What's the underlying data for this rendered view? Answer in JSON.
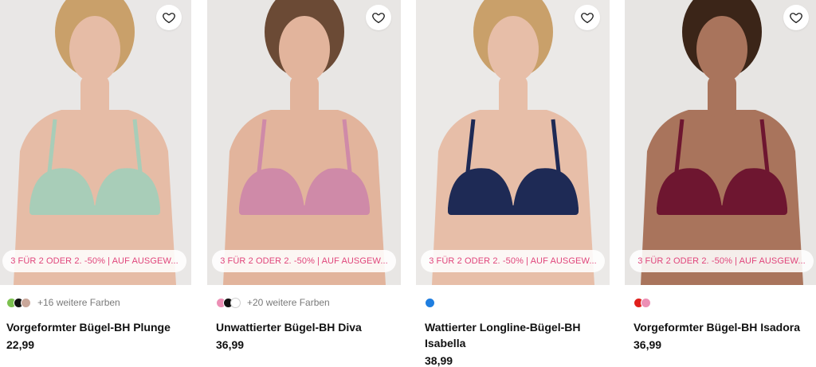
{
  "promo_text": "3 FÜR 2 ODER 2. -50% | AUF AUSGEW...",
  "products": [
    {
      "title": "Vorgeformter Bügel-BH Plunge",
      "price": "22,99",
      "swatches": [
        "#7cc04f",
        "#111111",
        "#c9a79a"
      ],
      "more_colors": "+16 weitere Farben",
      "bg": "#e9e7e6",
      "skin": "#e6bca6",
      "hair": "#c9a06a",
      "bra": "#a8cdb8"
    },
    {
      "title": "Unwattierter Bügel-BH Diva",
      "price": "36,99",
      "swatches": [
        "#ec8fb5",
        "#111111",
        "#ffffff"
      ],
      "more_colors": "+20 weitere Farben",
      "bg": "#e8e6e4",
      "skin": "#e2b49c",
      "hair": "#6b4a35",
      "bra": "#cf8aa8"
    },
    {
      "title": "Wattierter Longline-Bügel-BH Isabella",
      "price": "38,99",
      "swatches": [
        "#1f7ee0"
      ],
      "more_colors": "",
      "bg": "#ebe9e7",
      "skin": "#e7bea8",
      "hair": "#c9a06a",
      "bra": "#1e2a55"
    },
    {
      "title": "Vorgeformter Bügel-BH Isadora",
      "price": "36,99",
      "swatches": [
        "#e0201c",
        "#ec8fb5"
      ],
      "more_colors": "",
      "bg": "#e7e5e3",
      "skin": "#a9745c",
      "hair": "#3b2518",
      "bra": "#6e1630"
    }
  ]
}
